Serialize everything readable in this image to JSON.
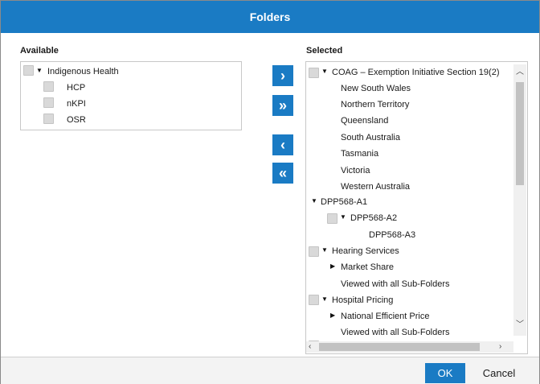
{
  "dialog": {
    "title": "Folders"
  },
  "available": {
    "label": "Available",
    "root": "Indigenous Health",
    "children": [
      "HCP",
      "nKPI",
      "OSR"
    ]
  },
  "move_buttons": {
    "move_right": "›",
    "move_all_right": "»",
    "move_left": "‹",
    "move_all_left": "«"
  },
  "selected": {
    "label": "Selected",
    "items": [
      "COAG – Exemption Initiative Section 19(2)",
      "New South Wales",
      "Northern Territory",
      "Queensland",
      "South Australia",
      "Tasmania",
      "Victoria",
      "Western Australia",
      "DPP568-A1",
      "DPP568-A2",
      "DPP568-A3",
      "Hearing Services",
      "Market Share",
      "Viewed with all Sub-Folders",
      "Hospital Pricing",
      "National Efficient Price",
      "Viewed with all Sub-Folders"
    ]
  },
  "footer": {
    "ok": "OK",
    "cancel": "Cancel"
  }
}
